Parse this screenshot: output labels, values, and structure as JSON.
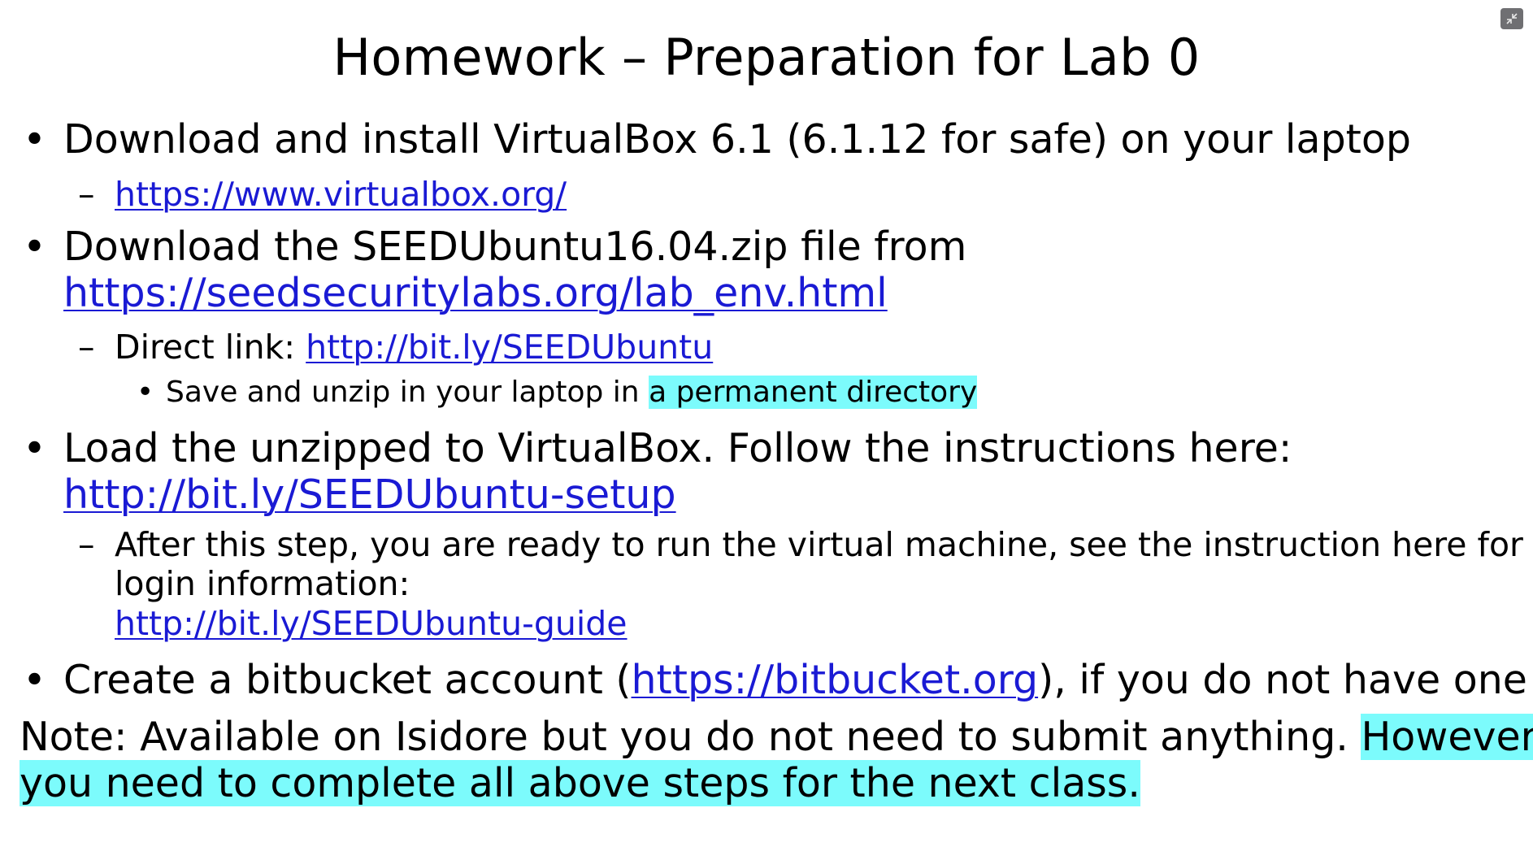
{
  "title": "Homework – Preparation for Lab 0",
  "items": {
    "b1": {
      "text": "Download and install VirtualBox 6.1 (6.1.12 for safe) on your laptop"
    },
    "b1_sub": {
      "dash": "–",
      "link": "https://www.virtualbox.org/"
    },
    "b2": {
      "text": "Download the SEEDUbuntu16.04.zip file from",
      "link": "https://seedsecuritylabs.org/lab_env.html"
    },
    "b2_sub": {
      "dash": "–",
      "prefix": "Direct link: ",
      "link": "http://bit.ly/SEEDUbuntu"
    },
    "b2_subsub": {
      "prefix": "Save and unzip in your laptop in ",
      "highlight": "a permanent directory"
    },
    "b3": {
      "text": "Load the unzipped to VirtualBox. Follow the instructions here:",
      "link": "http://bit.ly/SEEDUbuntu-setup"
    },
    "b3_sub": {
      "dash": "–",
      "line1": "After this step, you are ready to run the virtual machine, see the instruction here for",
      "line2": "login information:",
      "link": "http://bit.ly/SEEDUbuntu-guide"
    },
    "b4": {
      "prefix": "Create a bitbucket  account (",
      "link": "https://bitbucket.org",
      "suffix": "), if you do not have one"
    }
  },
  "note": {
    "line1_plain": "Note: Available on Isidore but you do not need to submit anything. ",
    "line1_highlight": "However,",
    "line2_highlight": "you need to complete all above steps for the next class."
  },
  "bullet_char": "•",
  "colors": {
    "link": "#1a1ad4",
    "highlight": "#7cfbfc",
    "text": "#000000"
  },
  "controls": {
    "collapse_icon": "collapse-icon"
  }
}
